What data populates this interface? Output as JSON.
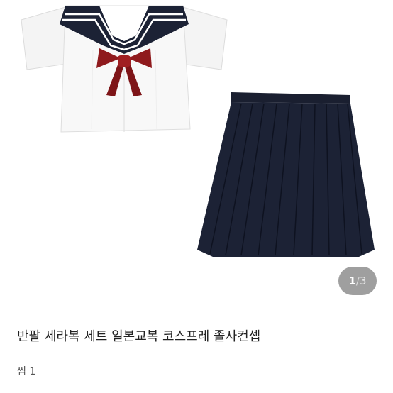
{
  "gallery": {
    "current": "1",
    "separator": "/",
    "total": "3",
    "colors": {
      "uniform_navy": "#1c2235",
      "bow_red": "#8f1a1d",
      "shirt_white": "#f7f7f7"
    }
  },
  "product": {
    "title": "반팔 세라복 세트 일본교복 코스프레 졸사컨셉",
    "likes_label": "찜",
    "likes_count": "1"
  }
}
